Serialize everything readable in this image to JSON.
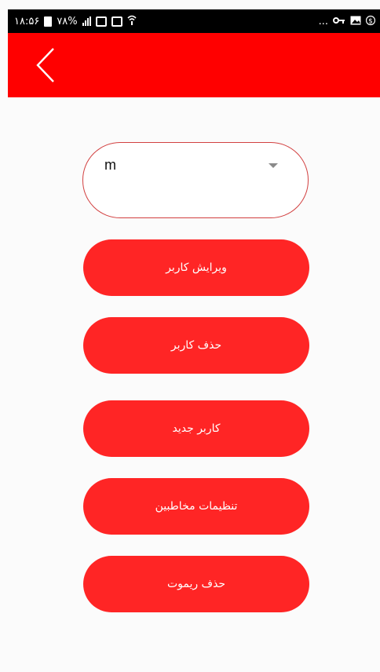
{
  "status_bar": {
    "time": "۱۸:۵۶",
    "battery_percent": "۷۸%",
    "dots": "...",
    "icons_left": [
      "battery-icon",
      "signal-icon",
      "box-icon",
      "notification-icon",
      "wifi-icon"
    ],
    "icons_right": [
      "key-icon",
      "image-icon",
      "dollar-icon"
    ]
  },
  "header": {
    "background_color": "#ff0000",
    "back_icon": "chevron-left-icon"
  },
  "user_select": {
    "selected_value": "m",
    "border_color": "#d24040",
    "arrow_icon": "caret-down-icon"
  },
  "buttons": [
    {
      "label": "ویرایش کاربر"
    },
    {
      "label": "حذف کاربر"
    },
    {
      "label": "کاربر جدید"
    },
    {
      "label": "تنظیمات مخاطبین"
    },
    {
      "label": "حذف ریموت"
    }
  ],
  "colors": {
    "primary": "#ff2525",
    "text_on_primary": "#ffffff"
  }
}
